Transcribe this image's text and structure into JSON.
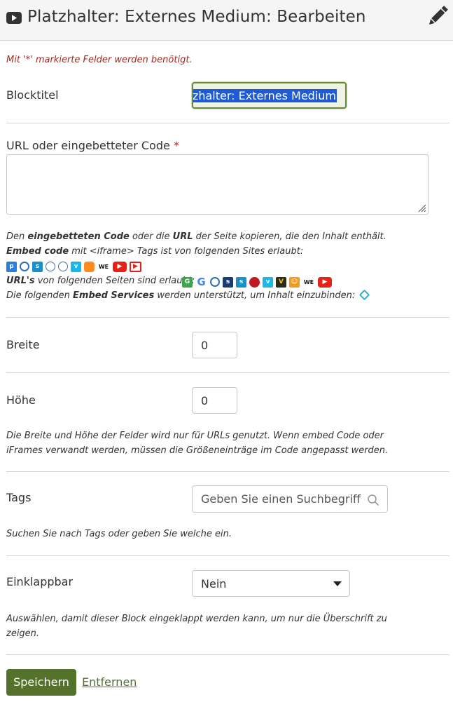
{
  "header": {
    "title": "Platzhalter: Externes Medium: Bearbeiten",
    "icon": "youtube-icon",
    "edit_icon": "pencil-icon"
  },
  "form": {
    "required_note": "Mit '*' markierte Felder werden benötigt.",
    "blocktitle": {
      "label": "Blocktitel",
      "value_visible": "zhalter: Externes Medium"
    },
    "url": {
      "label": "URL oder eingebetteter Code",
      "required_marker": "*",
      "value": ""
    },
    "help": {
      "line1_pre": "Den ",
      "line1_b1": "eingebetteten Code",
      "line1_mid": " oder die ",
      "line1_b2": "URL",
      "line1_post": " der Seite kopieren, die den Inhalt enthält.",
      "line2_b": "Embed code",
      "line2_post": " mit <iframe> Tags ist von folgenden Sites erlaubt:",
      "line4_b": "URL's",
      "line4_post": " von folgenden Seiten sind erlaubt:",
      "line5_pre": "Die folgenden ",
      "line5_b": "Embed Services",
      "line5_post": " werden unterstützt, um Inhalt einzubinden:",
      "embed_sites": [
        "padlet-icon",
        "prezi-icon",
        "slideshare-icon",
        "globe-icon",
        "globe-icon",
        "vimeo-icon",
        "voki-icon",
        "wikieducator-icon",
        "youtube-icon",
        "youtube-icon"
      ],
      "url_sites": [
        "glogster-icon",
        "google-icon",
        "prezi-icon",
        "scivee-icon",
        "slideshare-icon",
        "teachertube-icon",
        "vimeo-icon",
        "voicethread-icon",
        "wikieducator-icon",
        "we-icon",
        "youtube-icon"
      ],
      "embed_services": [
        "embedly-icon"
      ]
    },
    "width": {
      "label": "Breite",
      "value": "0"
    },
    "height": {
      "label": "Höhe",
      "value": "0"
    },
    "size_help_1": "Die Breite und Höhe der Felder wird nur für URLs genutzt. Wenn embed Code oder",
    "size_help_2": "iFrames verwandt werden, müssen die Größeneinträge im Code angepasst werden.",
    "tags": {
      "label": "Tags",
      "placeholder": "Geben Sie einen Suchbegriff ein",
      "help": "Suchen Sie nach Tags oder geben Sie welche ein."
    },
    "collapsible": {
      "label": "Einklappbar",
      "value": "Nein",
      "help_1": "Auswählen, damit dieser Block eingeklappt werden kann, um nur die Überschrift zu",
      "help_2": "zeigen."
    },
    "save_label": "Speichern",
    "remove_label": "Entfernen"
  },
  "colors": {
    "accent": "#55722a",
    "required": "#a02a20",
    "selection": "#1f5bd5"
  }
}
